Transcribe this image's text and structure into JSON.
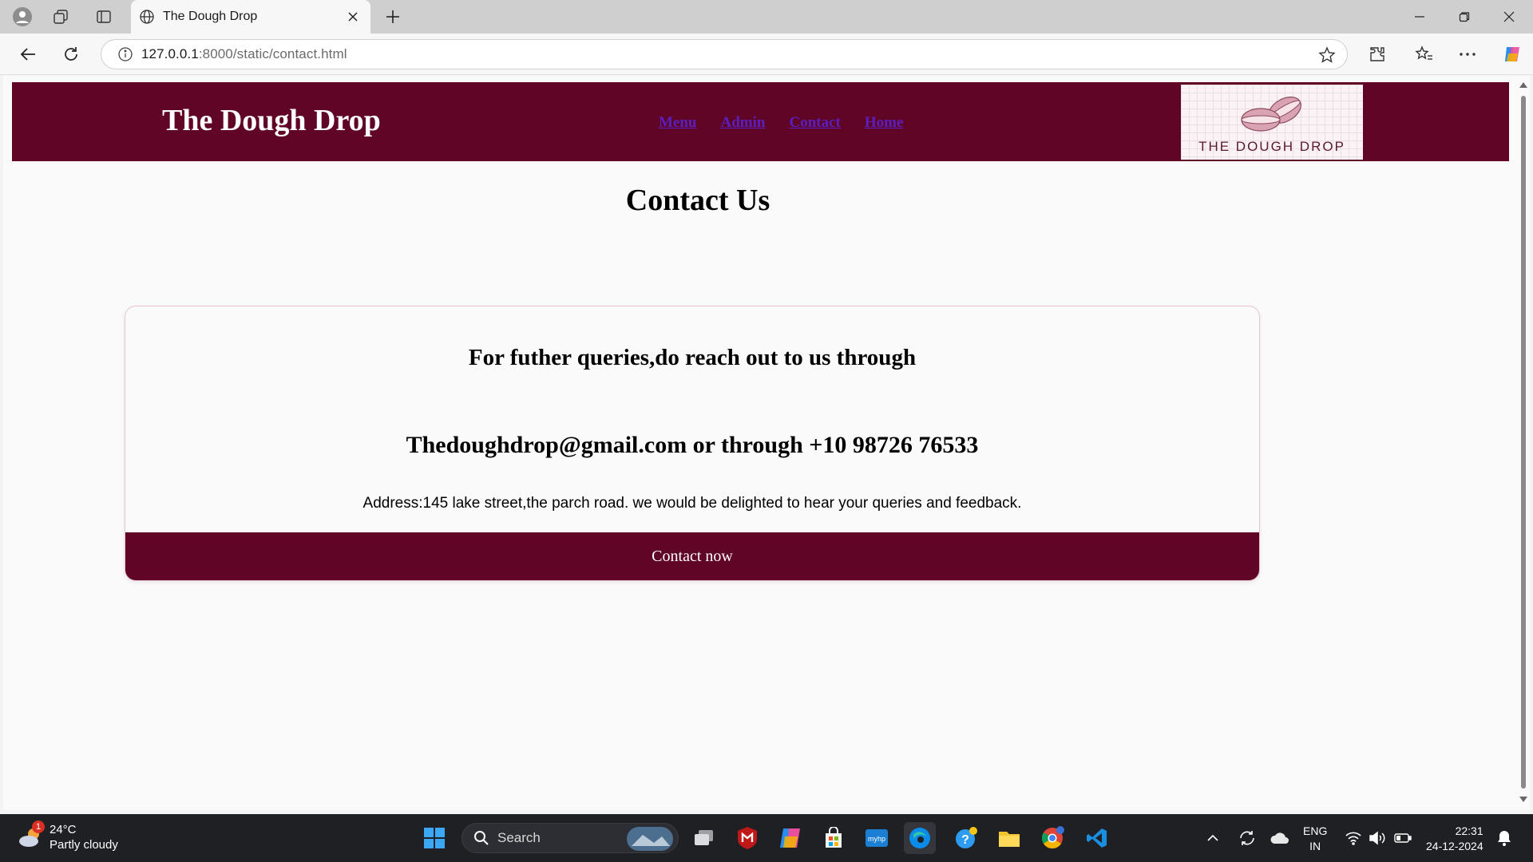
{
  "browser": {
    "tab_title": "The Dough Drop",
    "url_host": "127.0.0.1",
    "url_rest": ":8000/static/contact.html"
  },
  "site": {
    "brand": "The Dough Drop",
    "nav": [
      "Menu",
      "Admin",
      "Contact",
      "Home"
    ],
    "logo_text": "THE DOUGH DROP"
  },
  "page": {
    "title": "Contact Us",
    "card": {
      "heading": "For futher queries,do reach out to us through",
      "contact_line": "Thedoughdrop@gmail.com or through +10 98726 76533",
      "address": "Address:145 lake street,the parch road. we would be delighted to hear your queries and feedback.",
      "button": "Contact now"
    }
  },
  "taskbar": {
    "weather_temp": "24°C",
    "weather_desc": "Partly cloudy",
    "weather_badge": "1",
    "search_placeholder": "Search",
    "lang_top": "ENG",
    "lang_bottom": "IN",
    "time": "22:31",
    "date": "24-12-2024"
  },
  "colors": {
    "brand_maroon": "#600526",
    "nav_link": "#5b1fc1"
  }
}
